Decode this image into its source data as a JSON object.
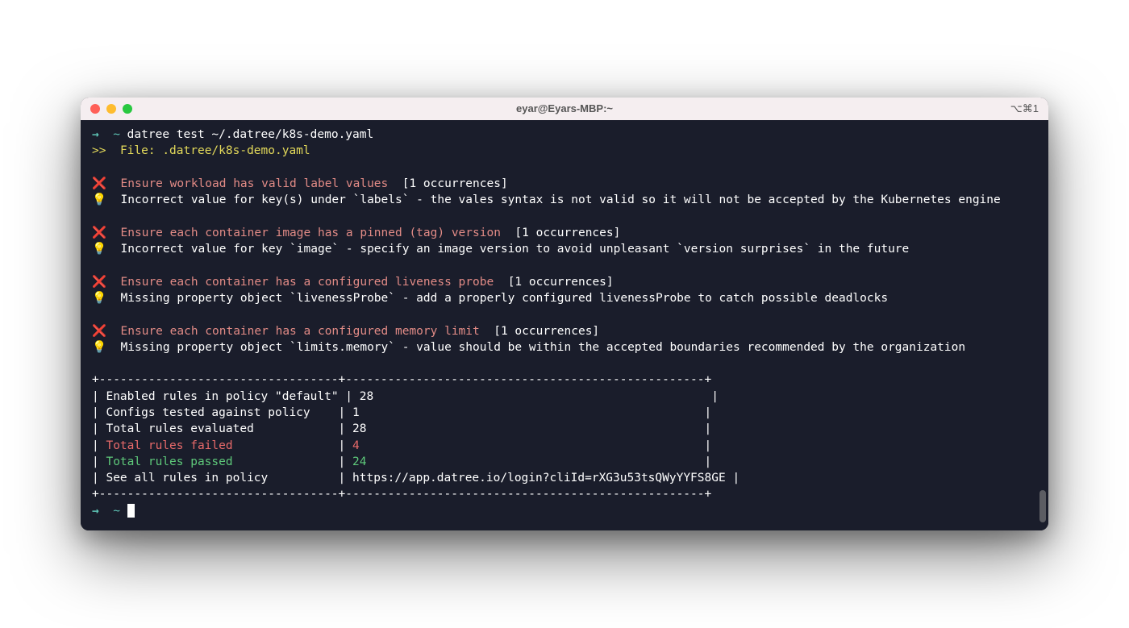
{
  "window": {
    "title": "eyar@Eyars-MBP:~",
    "shortcut": "⌥⌘1"
  },
  "prompt": {
    "arrow": "→",
    "tilde": "~",
    "command": "datree test ~/.datree/k8s-demo.yaml"
  },
  "file_line": {
    "prefix": ">>",
    "label": "File: .datree/k8s-demo.yaml"
  },
  "violations": [
    {
      "rule": "Ensure workload has valid label values",
      "occurrences": "[1 occurrences]",
      "detail": "Incorrect value for key(s) under `labels` - the vales syntax is not valid so it will not be accepted by the Kubernetes engine"
    },
    {
      "rule": "Ensure each container image has a pinned (tag) version",
      "occurrences": "[1 occurrences]",
      "detail": "Incorrect value for key `image` - specify an image version to avoid unpleasant `version surprises` in the future"
    },
    {
      "rule": "Ensure each container has a configured liveness probe",
      "occurrences": "[1 occurrences]",
      "detail": "Missing property object `livenessProbe` - add a properly configured livenessProbe to catch possible deadlocks"
    },
    {
      "rule": "Ensure each container has a configured memory limit",
      "occurrences": "[1 occurrences]",
      "detail": "Missing property object `limits.memory` - value should be within the accepted boundaries recommended by the organization"
    }
  ],
  "summary": {
    "divider": "+----------------------------------+---------------------------------------------------+",
    "rows": [
      {
        "label": "Enabled rules in policy \"default\"",
        "value": "28",
        "color": "white"
      },
      {
        "label": "Configs tested against policy",
        "value": "1",
        "color": "white"
      },
      {
        "label": "Total rules evaluated",
        "value": "28",
        "color": "white"
      },
      {
        "label": "Total rules failed",
        "value": "4",
        "color": "red"
      },
      {
        "label": "Total rules passed",
        "value": "24",
        "color": "green"
      },
      {
        "label": "See all rules in policy",
        "value": "https://app.datree.io/login?cliId=rXG3u53tsQWyYYFS8GE",
        "color": "white"
      }
    ]
  },
  "glyphs": {
    "x": "❌",
    "bulb": "💡"
  }
}
